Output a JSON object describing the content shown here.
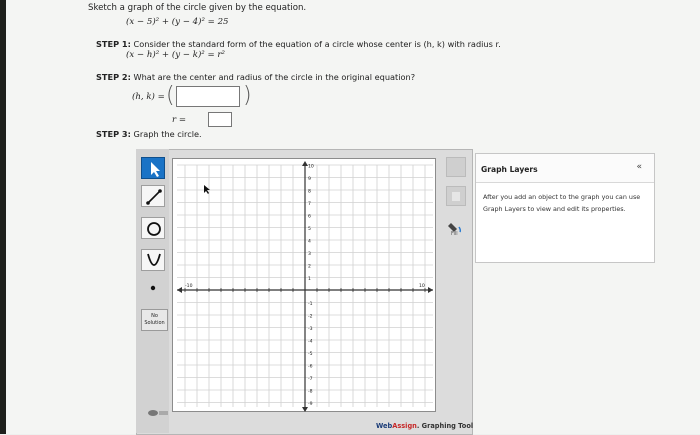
{
  "question": {
    "prompt": "Sketch a graph of the circle given by the equation.",
    "equation": "(x − 5)² + (y − 4)² = 25"
  },
  "steps": {
    "step1_label": "STEP 1:",
    "step1_text": "Consider the standard form of the equation of a circle whose center is (h, k) with radius r.",
    "step1_formula": "(x − h)² + (y − k)² = r²",
    "step2_label": "STEP 2:",
    "step2_text": "What are the center and radius of the circle in the original equation?",
    "center_label": "(h, k) =",
    "center_value": "",
    "radius_label": "r =",
    "radius_value": "",
    "step3_label": "STEP 3:",
    "step3_text": "Graph the circle."
  },
  "graph_tool": {
    "tools": [
      "select-arrow",
      "line-segment",
      "circle",
      "parabola",
      "point"
    ],
    "no_solution_label": "No Solution",
    "fill_label": "Fill",
    "y_tick_labels": [
      "10",
      "9",
      "8",
      "7",
      "6",
      "5",
      "4",
      "3",
      "2",
      "1",
      "-1",
      "-2",
      "-3",
      "-4",
      "-5",
      "-6",
      "-7",
      "-8",
      "-9",
      "-10"
    ],
    "x_range": [
      -10,
      10
    ],
    "y_range": [
      -10,
      10
    ],
    "x_tick_start": "-10",
    "x_tick_end": "10",
    "colors": {
      "selected_tool": "#1a73c6",
      "axis": "#333333",
      "grid": "#d0d0d0"
    }
  },
  "layers_panel": {
    "title": "Graph Layers",
    "collapse_icon": "«",
    "body": "After you add an object to the graph you can use Graph Layers to view and edit its properties."
  },
  "branding": {
    "web": "Web",
    "assign": "Assign",
    "suffix": ". Graphing Tool"
  }
}
